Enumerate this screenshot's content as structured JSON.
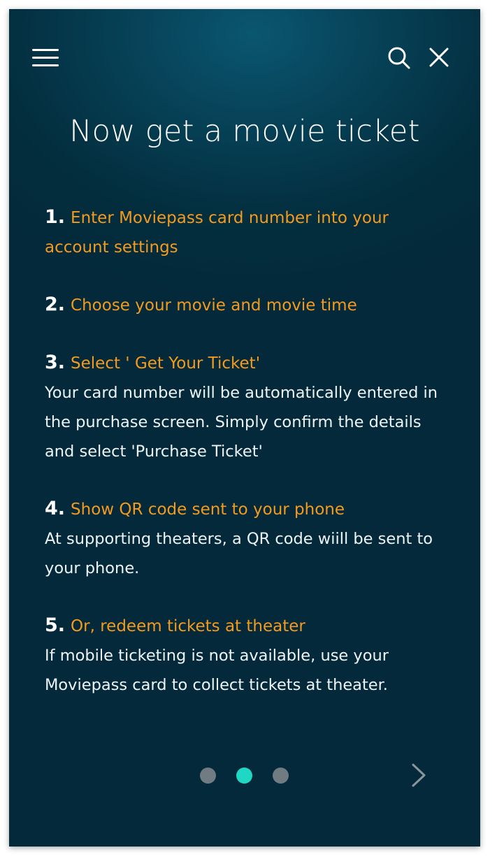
{
  "header": {
    "menu_icon": "menu-icon",
    "search_icon": "search-icon",
    "close_icon": "close-icon"
  },
  "title": "Now get a movie ticket",
  "steps": [
    {
      "number": "1.",
      "heading": "Enter Moviepass card number into your account settings",
      "description": ""
    },
    {
      "number": "2.",
      "heading": "Choose your movie and movie time",
      "description": ""
    },
    {
      "number": "3.",
      "heading": "Select ' Get Your Ticket'",
      "description": "Your card number will be automatically entered in the purchase screen. Simply confirm the details and select 'Purchase Ticket'"
    },
    {
      "number": "4.",
      "heading": "Show QR code sent to your phone",
      "description": "At supporting theaters, a QR code wiill be sent to your phone."
    },
    {
      "number": "5.",
      "heading": "Or, redeem tickets at theater",
      "description": "If mobile ticketing is not available, use your Moviepass card to collect tickets at theater."
    }
  ],
  "pager": {
    "total_pages": 3,
    "current_page": 2,
    "active_color": "#1fd8c4",
    "inactive_color": "#707b82"
  },
  "colors": {
    "background": "#043447",
    "accent_orange": "#f39a1f",
    "text": "#ffffff"
  },
  "next_icon": "chevron-right-icon"
}
